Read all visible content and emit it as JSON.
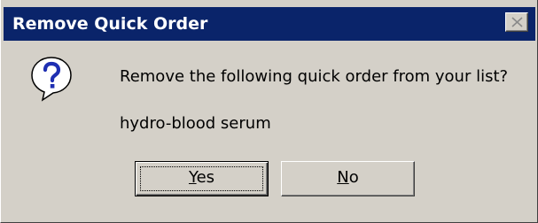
{
  "window": {
    "title": "Remove Quick Order"
  },
  "message": {
    "prompt": "Remove the following quick order from your list?",
    "item": "hydro-blood serum"
  },
  "buttons": {
    "yes": {
      "accel": "Y",
      "rest": "es"
    },
    "no": {
      "accel": "N",
      "rest": "o"
    }
  },
  "icons": {
    "question": "question-icon",
    "close": "close-icon"
  },
  "colors": {
    "titlebar": "#0a246a",
    "dialog_face": "#d4d0c8",
    "question_mark": "#1f2fb2"
  }
}
